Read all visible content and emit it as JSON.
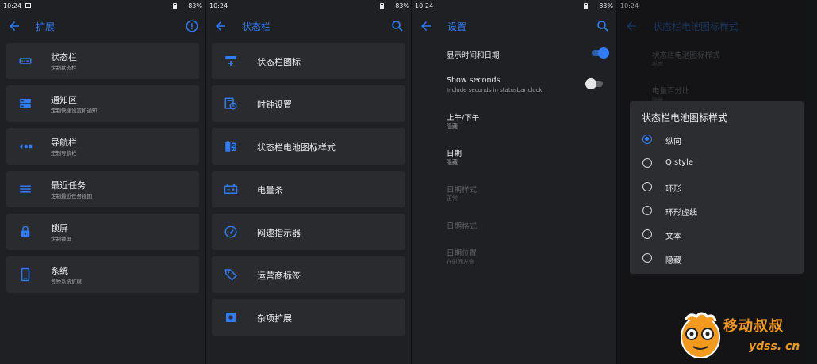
{
  "colors": {
    "accent": "#2f7cf6",
    "card": "#2a2b2f",
    "background": "#1f2023",
    "watermark": "#f29a1e"
  },
  "panel1": {
    "status": {
      "time": "10:24",
      "battery": "83%"
    },
    "title": "扩展",
    "items": [
      {
        "title": "状态栏",
        "subtitle": "定制状态栏",
        "icon": "statusbar-icon"
      },
      {
        "title": "通知区",
        "subtitle": "定制快捷设置和通知",
        "icon": "notification-area-icon"
      },
      {
        "title": "导航栏",
        "subtitle": "定制导航栏",
        "icon": "navigation-bar-icon"
      },
      {
        "title": "最近任务",
        "subtitle": "定制最近任务视图",
        "icon": "recents-icon"
      },
      {
        "title": "锁屏",
        "subtitle": "定制锁屏",
        "icon": "lock-icon"
      },
      {
        "title": "系统",
        "subtitle": "各种系统扩展",
        "icon": "phone-icon"
      }
    ]
  },
  "panel2": {
    "status": {
      "time": "10:24",
      "battery": "83%"
    },
    "title": "状态栏",
    "items": [
      {
        "title": "状态栏图标",
        "icon": "statusbar-icons-icon"
      },
      {
        "title": "时钟设置",
        "icon": "clock-settings-icon"
      },
      {
        "title": "状态栏电池图标样式",
        "icon": "battery-style-icon"
      },
      {
        "title": "电量条",
        "icon": "battery-bar-icon"
      },
      {
        "title": "网速指示器",
        "icon": "speedometer-icon"
      },
      {
        "title": "运营商标签",
        "icon": "tag-icon"
      },
      {
        "title": "杂项扩展",
        "icon": "misc-icon"
      }
    ]
  },
  "panel3": {
    "status": {
      "time": "10:24",
      "battery": "83%"
    },
    "title": "设置",
    "settings": [
      {
        "title": "显示时间和日期",
        "subtitle": "",
        "toggle": true
      },
      {
        "title": "Show seconds",
        "subtitle": "Include seconds in statusbar clock",
        "toggle": false
      },
      {
        "title": "上午/下午",
        "subtitle": "隐藏"
      },
      {
        "title": "日期",
        "subtitle": "隐藏"
      },
      {
        "title": "日期样式",
        "subtitle": "正常",
        "disabled": true
      },
      {
        "title": "日期格式",
        "subtitle": "",
        "disabled": true
      },
      {
        "title": "日期位置",
        "subtitle": "在时间左侧",
        "disabled": true
      }
    ]
  },
  "panel4": {
    "status": {
      "time": "10:24"
    },
    "title": "状态栏电池图标样式",
    "background_items": [
      {
        "title": "状态栏电池图标样式",
        "subtitle": "纵向"
      },
      {
        "title": "电量百分比",
        "subtitle": "隐藏"
      }
    ],
    "dialog": {
      "title": "状态栏电池图标样式",
      "options": [
        "纵向",
        "Q style",
        "环形",
        "环形虚线",
        "文本",
        "隐藏"
      ],
      "selected": "纵向"
    }
  },
  "watermark": {
    "text": "移动叔叔",
    "url": "ydss. cn"
  }
}
